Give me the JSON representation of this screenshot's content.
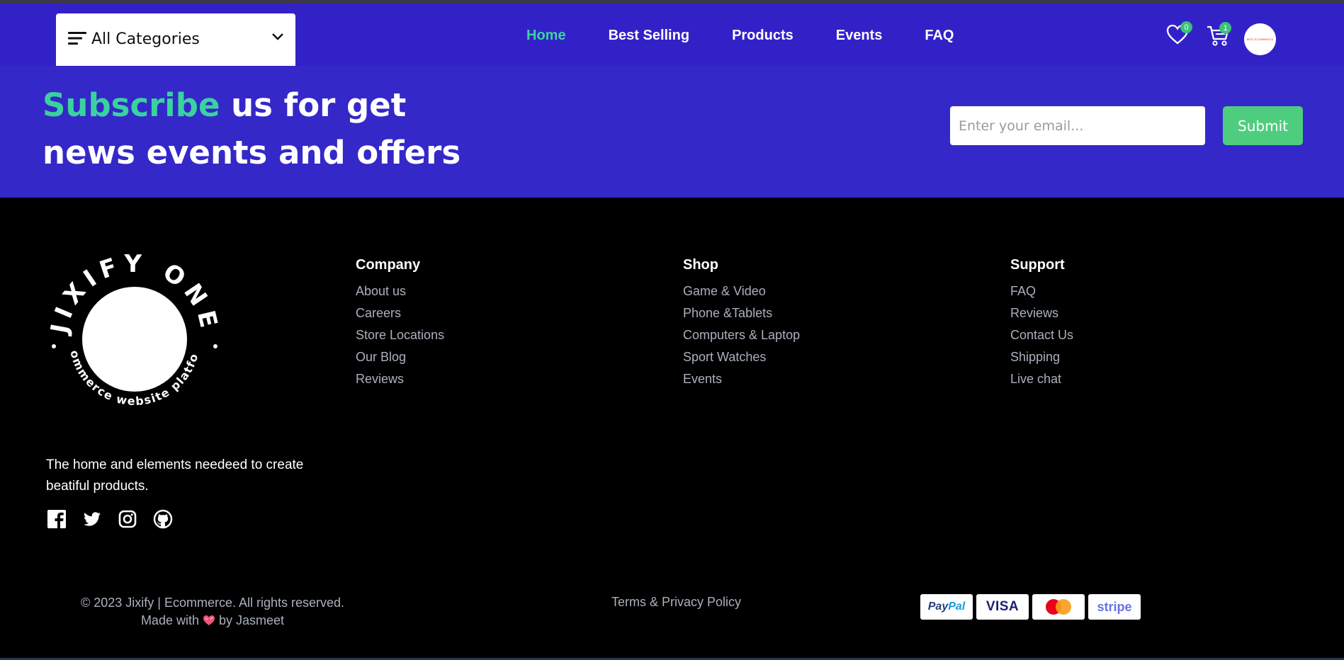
{
  "header": {
    "categories_label": "All Categories",
    "nav": [
      {
        "label": "Home",
        "active": true
      },
      {
        "label": "Best Selling",
        "active": false
      },
      {
        "label": "Products",
        "active": false
      },
      {
        "label": "Events",
        "active": false
      },
      {
        "label": "FAQ",
        "active": false
      }
    ],
    "wishlist_count": "0",
    "cart_count": "1",
    "avatar_text": "BEST ECOMMERCE",
    "accent_color": "#3ad29f",
    "brand_color": "#3321c8"
  },
  "subscribe": {
    "title_highlight": "Subscribe",
    "title_rest": " us for get news events and offers",
    "email_placeholder": "Enter your email...",
    "submit_label": "Submit"
  },
  "footer": {
    "logo_top_text": "JIXIFY ONE",
    "logo_bottom_text": "ecommerce website platform",
    "tagline": "The home and elements needeed to create beatiful products.",
    "socials": [
      "facebook-icon",
      "twitter-icon",
      "instagram-icon",
      "github-icon"
    ],
    "columns": [
      {
        "title": "Company",
        "links": [
          "About us",
          "Careers",
          "Store Locations",
          "Our Blog",
          "Reviews"
        ]
      },
      {
        "title": "Shop",
        "links": [
          "Game & Video",
          "Phone &Tablets",
          "Computers & Laptop",
          "Sport Watches",
          "Events"
        ]
      },
      {
        "title": "Support",
        "links": [
          "FAQ",
          "Reviews",
          "Contact Us",
          "Shipping",
          "Live chat"
        ]
      }
    ],
    "copyright": "© 2023 Jixify | Ecommerce. All rights reserved.",
    "made_with_prefix": "Made with",
    "made_with_suffix": "by Jasmeet",
    "terms": "Terms & Privacy Policy",
    "payments": {
      "paypal_a": "Pay",
      "paypal_b": "Pal",
      "visa": "VISA",
      "stripe": "stripe"
    }
  }
}
